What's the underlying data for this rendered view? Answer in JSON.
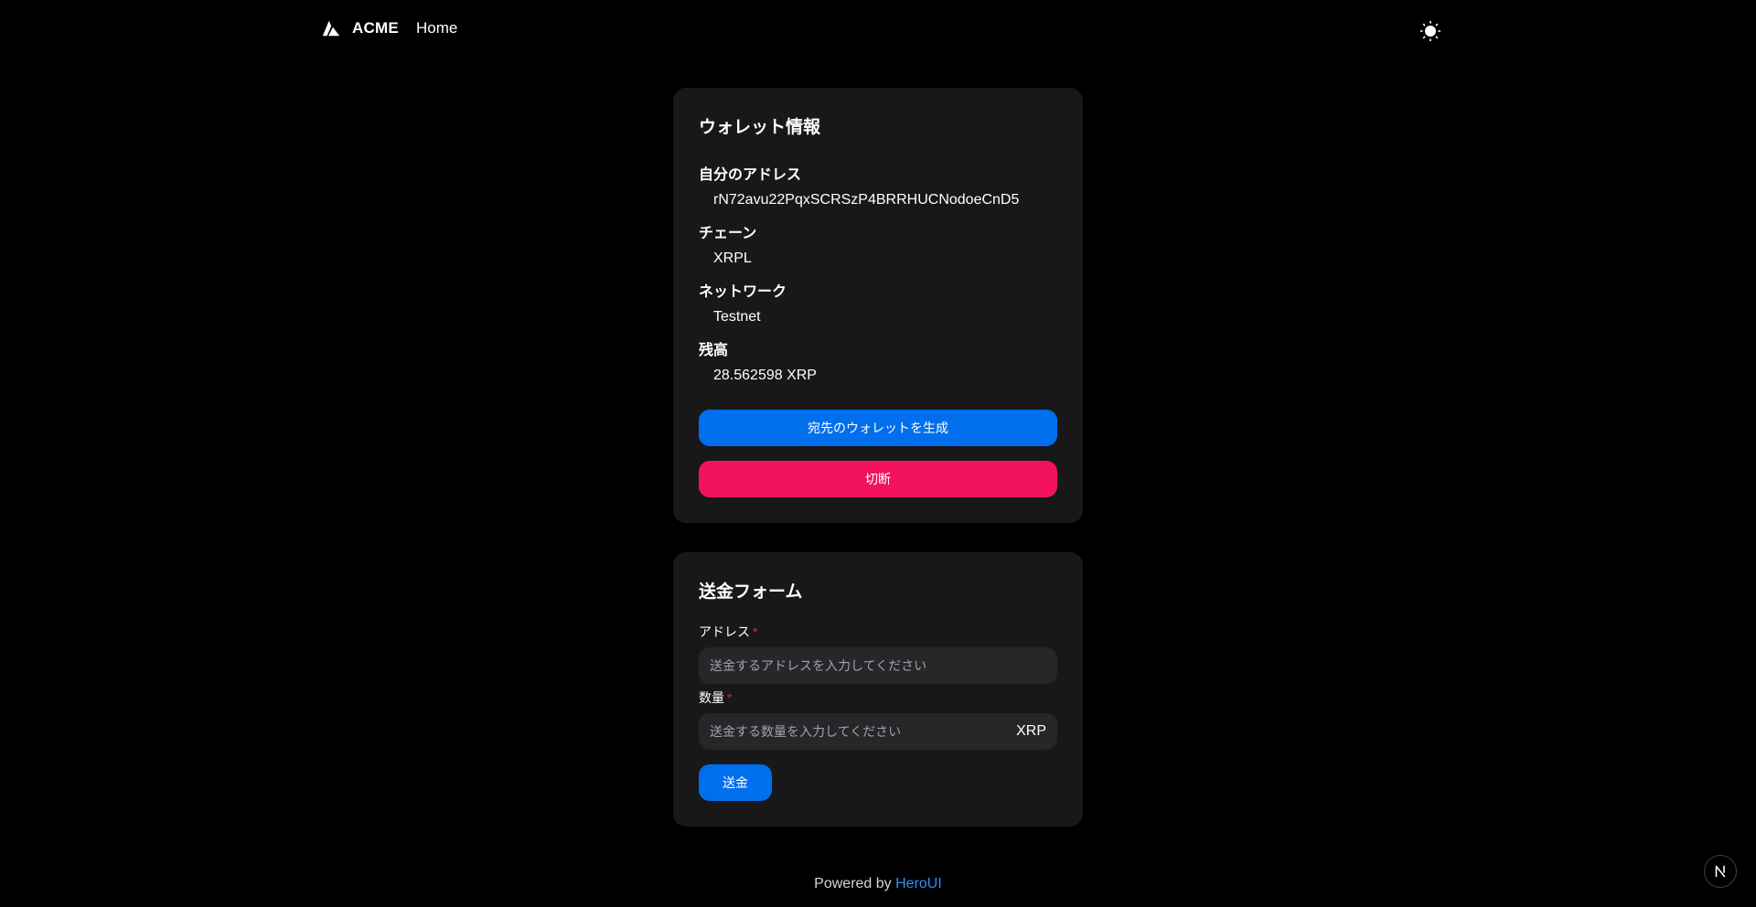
{
  "navbar": {
    "brand": "ACME",
    "home_link": "Home",
    "theme_icon": "sun-icon"
  },
  "wallet_card": {
    "title": "ウォレット情報",
    "address_label": "自分のアドレス",
    "address_value": "rN72avu22PqxSCRSzP4BRRHUCNodoeCnD5",
    "chain_label": "チェーン",
    "chain_value": "XRPL",
    "network_label": "ネットワーク",
    "network_value": "Testnet",
    "balance_label": "残高",
    "balance_value": "28.562598 XRP",
    "generate_button": "宛先のウォレットを生成",
    "disconnect_button": "切断"
  },
  "send_card": {
    "title": "送金フォーム",
    "address_label": "アドレス",
    "address_placeholder": "送金するアドレスを入力してください",
    "amount_label": "数量",
    "amount_placeholder": "送金する数量を入力してください",
    "amount_unit": "XRP",
    "required_mark": "*",
    "submit_button": "送金"
  },
  "footer": {
    "prefix": "Powered by",
    "link": "HeroUI"
  },
  "colors": {
    "background": "#000000",
    "card": "#18181b",
    "primary": "#006fee",
    "danger": "#f31260",
    "input": "#27272a",
    "link": "#338ef7"
  }
}
